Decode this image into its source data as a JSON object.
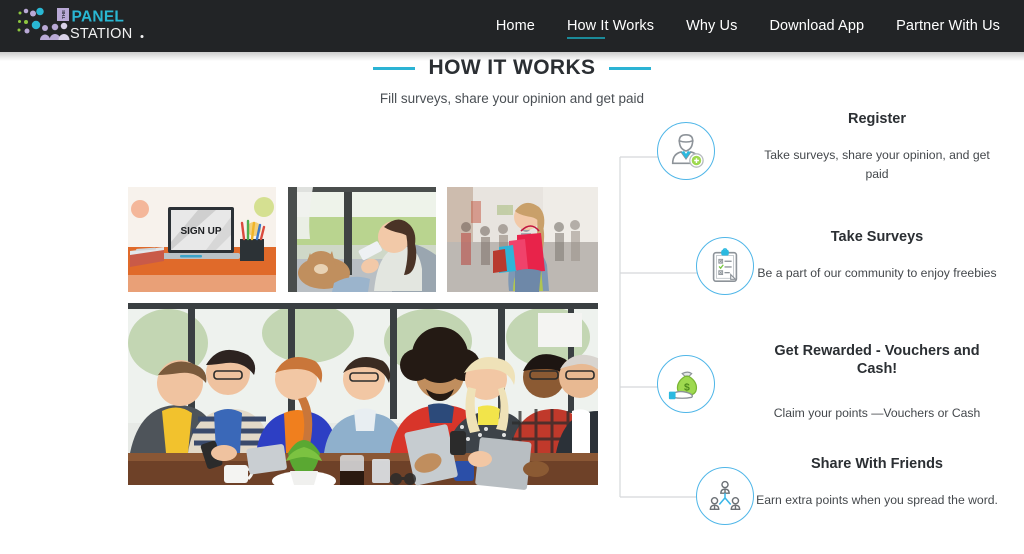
{
  "brand": {
    "name_line1": "PANEL",
    "name_line2": "STATION",
    "badge": "THE",
    "color_primary": "#29b7d3",
    "color_secondary": "#b9a9d6"
  },
  "nav": {
    "items": [
      {
        "label": "Home",
        "active": false
      },
      {
        "label": "How It Works",
        "active": true
      },
      {
        "label": "Why Us",
        "active": false
      },
      {
        "label": "Download App",
        "active": false
      },
      {
        "label": "Partner With Us",
        "active": false
      }
    ],
    "active_underline_color": "#1b8a99"
  },
  "section": {
    "title": "HOW IT WORKS",
    "subtitle": "Fill surveys, share your opinion and get paid",
    "dash_color": "#2bb3d4"
  },
  "collage": {
    "images": [
      {
        "name": "laptop-sign-up-desk",
        "caption": "SIGN UP"
      },
      {
        "name": "woman-on-couch-with-phone-and-dog",
        "caption": ""
      },
      {
        "name": "woman-shopping-with-bags-on-street",
        "caption": ""
      },
      {
        "name": "group-of-friends-around-table-with-devices",
        "caption": ""
      }
    ]
  },
  "steps": [
    {
      "icon": "register-person-icon",
      "title": "Register",
      "desc": "Take surveys, share your opinion, and get paid"
    },
    {
      "icon": "clipboard-survey-icon",
      "title": "Take Surveys",
      "desc": "Be a part of our community to enjoy freebies"
    },
    {
      "icon": "money-bag-reward-icon",
      "title": "Get Rewarded - Vouchers and Cash!",
      "desc": "Claim your points —Vouchers or Cash"
    },
    {
      "icon": "share-network-people-icon",
      "title": "Share With Friends",
      "desc": "Earn extra points when you spread the word."
    }
  ]
}
